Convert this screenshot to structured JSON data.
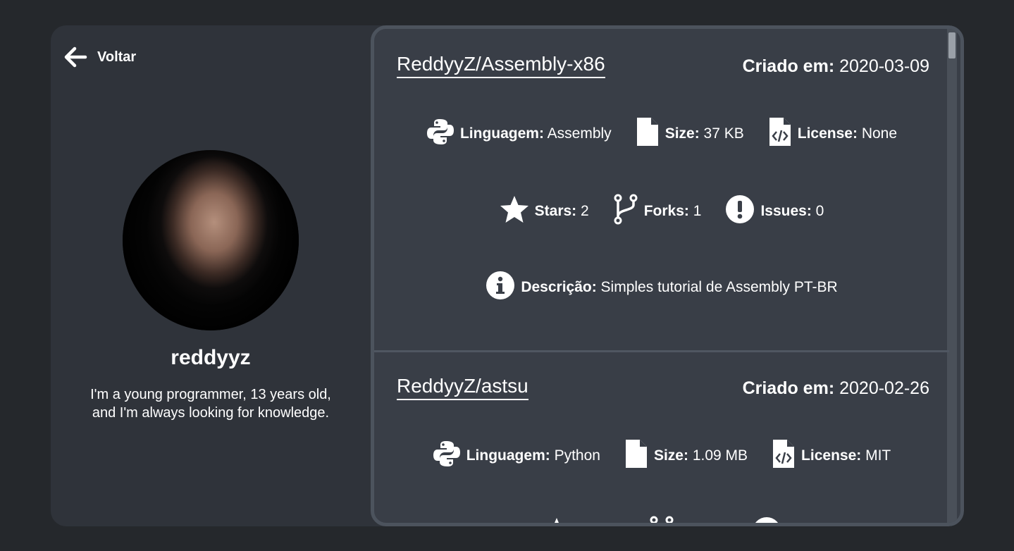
{
  "back": {
    "label": "Voltar"
  },
  "profile": {
    "username": "reddyyz",
    "bio": "I'm a young programmer, 13 years old, and I'm always looking for knowledge."
  },
  "labels": {
    "created": "Criado em:",
    "language": "Linguagem:",
    "size": "Size:",
    "license": "License:",
    "stars": "Stars:",
    "forks": "Forks:",
    "issues": "Issues:",
    "description": "Descrição:"
  },
  "repos": [
    {
      "name": "ReddyyZ/Assembly-x86",
      "created": "2020-03-09",
      "language": "Assembly",
      "size": "37 KB",
      "license": "None",
      "stars": "2",
      "forks": "1",
      "issues": "0",
      "description": "Simples tutorial de Assembly PT-BR"
    },
    {
      "name": "ReddyyZ/astsu",
      "created": "2020-02-26",
      "language": "Python",
      "size": "1.09 MB",
      "license": "MIT"
    }
  ],
  "colors": {
    "page_bg": "#25282c",
    "card_bg": "#2f333a",
    "panel_bg": "#393e47",
    "text": "#ffffff"
  }
}
